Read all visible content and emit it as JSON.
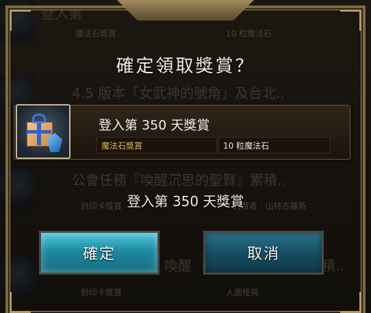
{
  "background_list": {
    "rows": [
      {
        "title": "登入第",
        "type": "魔法石獎賞",
        "value": "10 粒魔法石"
      },
      {
        "title": "4.5 版本「女武神的號角」及台北..",
        "type": "",
        "value": ""
      },
      {
        "title": "公會任務『喚醒沉思的聖賢』累積..",
        "type": "封印卡獎賞",
        "value": "的賢者 · 山特古羅斯"
      },
      {
        "title": "喚醒",
        "title_suffix": "積..",
        "type": "封印卡獎賞",
        "value": "人面怪鳥"
      }
    ]
  },
  "dialog": {
    "title": "確定領取獎賞？",
    "reward": {
      "name": "登入第 350 天獎賞",
      "type_label": "魔法石獎賞",
      "value_label": "10 粒魔法石",
      "icon": "gift-box-with-gem-icon"
    },
    "subtitle": "登入第 350 天獎賞",
    "buttons": {
      "confirm": "確定",
      "cancel": "取消"
    }
  },
  "colors": {
    "confirm_button": "#1d8aa2",
    "cancel_button": "#174e62",
    "reward_type_text": "#e0b64a",
    "frame_gold": "#a08b5c"
  }
}
